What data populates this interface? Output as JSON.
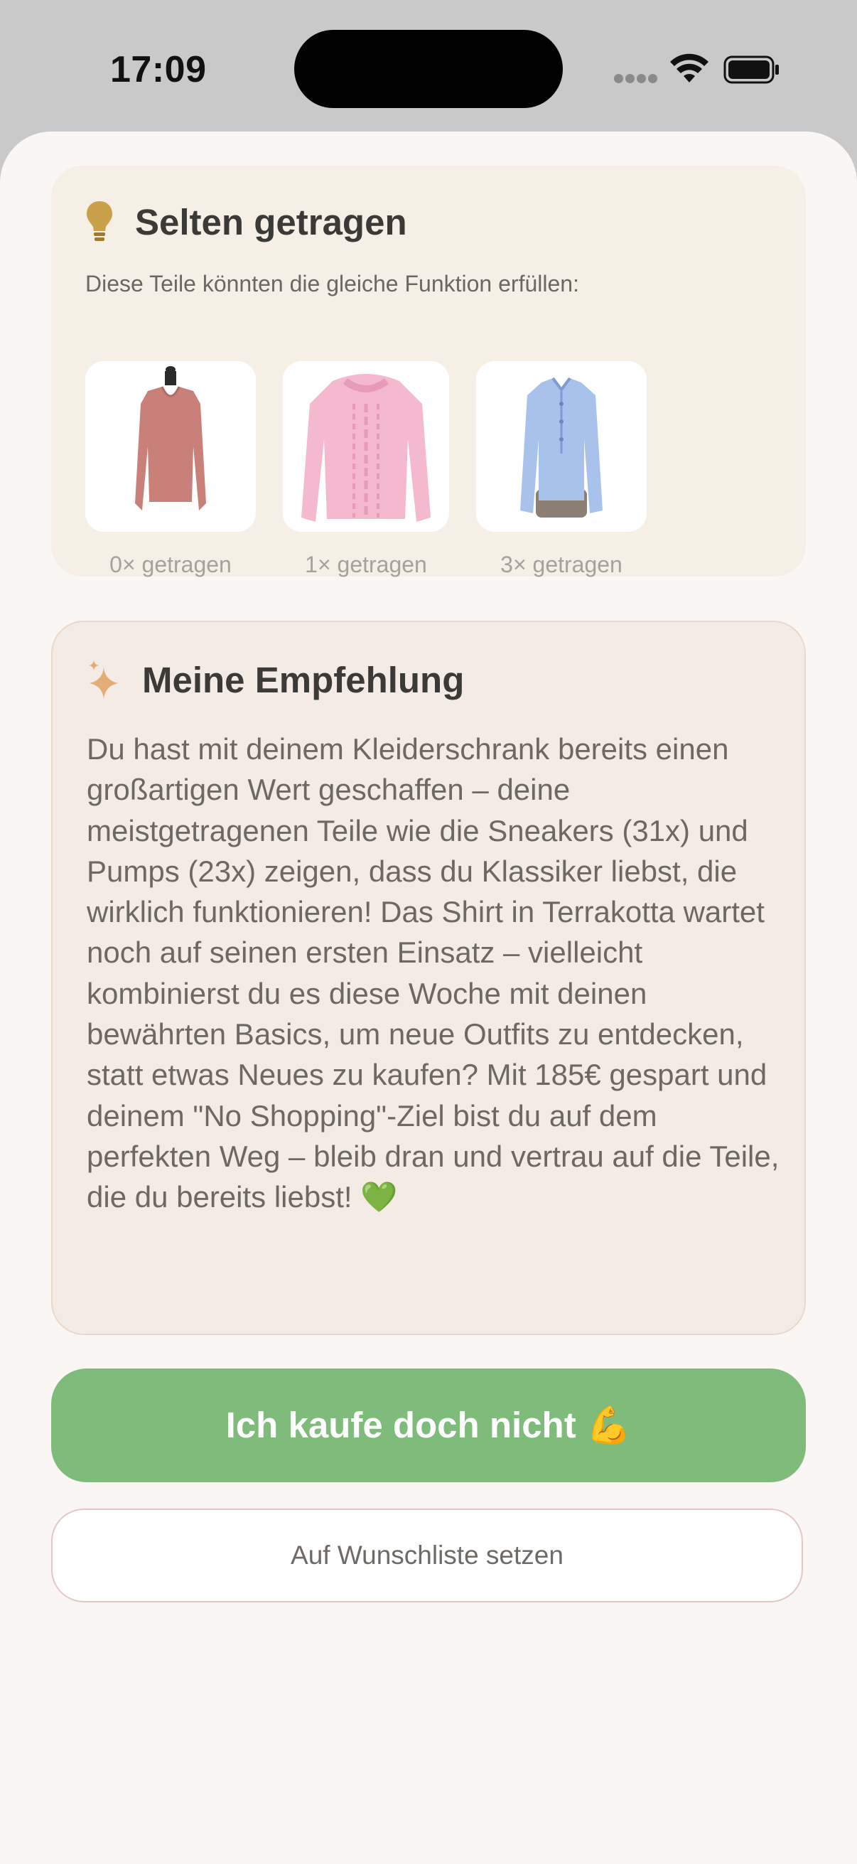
{
  "status_bar": {
    "time": "17:09"
  },
  "rarely_worn": {
    "icon": "lightbulb-icon",
    "title": "Selten getragen",
    "subtitle": "Diese Teile könnten die gleiche Funktion erfüllen:",
    "items": [
      {
        "image": "pink-knit-longsleeve-image",
        "worn": "0× getragen"
      },
      {
        "image": "pink-cable-knit-sweater-image",
        "worn": "1× getragen"
      },
      {
        "image": "light-blue-blouse-image",
        "worn": "3× getragen"
      }
    ]
  },
  "recommendation": {
    "icon": "sparkle-icon",
    "title": "Meine Empfehlung",
    "text": "Du hast mit deinem Kleiderschrank bereits einen großartigen Wert geschaffen – deine meistgetragenen Teile wie die Sneakers (31x) und Pumps (23x) zeigen, dass du Klassiker liebst, die wirklich funktionieren! Das Shirt in Terrakotta wartet noch auf seinen ersten Einsatz – vielleicht kombinierst du es diese Woche mit deinen bewährten Basics, um neue Outfits zu entdecken, statt etwas Neues zu kaufen? Mit 185€ gespart und deinem \"No Shopping\"-Ziel bist du auf dem perfekten Weg – bleib dran und vertrau auf die Teile, die du bereits liebst! 💚"
  },
  "actions": {
    "primary_label": "Ich kaufe doch nicht 💪",
    "secondary_label": "Auf Wunschliste setzen"
  },
  "colors": {
    "primary_button": "#7fbc7c",
    "background": "#faf6f3",
    "card": "#f6efe6",
    "accent": "#c9a14a"
  }
}
